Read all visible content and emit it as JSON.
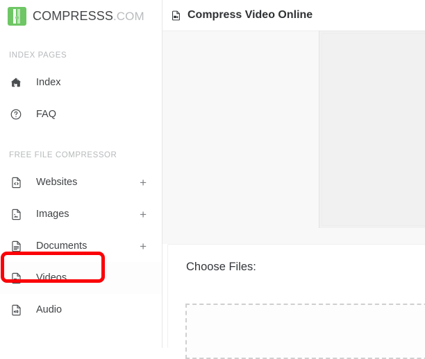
{
  "brand": {
    "name_primary": "COMPRESSS",
    "name_secondary": ".COM",
    "logo_icon": "compress-logo-icon",
    "logo_color": "#6ec664"
  },
  "sidebar": {
    "sections": [
      {
        "title": "INDEX PAGES",
        "items": [
          {
            "label": "Index",
            "icon": "home-icon",
            "expander": "",
            "active": false
          },
          {
            "label": "FAQ",
            "icon": "question-circle-icon",
            "expander": "",
            "active": false
          }
        ]
      },
      {
        "title": "FREE FILE COMPRESSOR",
        "items": [
          {
            "label": "Websites",
            "icon": "file-code-icon",
            "expander": "+",
            "active": false
          },
          {
            "label": "Images",
            "icon": "file-image-icon",
            "expander": "+",
            "active": false
          },
          {
            "label": "Documents",
            "icon": "file-document-icon",
            "expander": "+",
            "active": false
          },
          {
            "label": "Videos",
            "icon": "file-video-icon",
            "expander": "",
            "active": true
          },
          {
            "label": "Audio",
            "icon": "file-audio-icon",
            "expander": "",
            "active": false
          }
        ]
      }
    ]
  },
  "annotation": {
    "target": "Videos",
    "shape": "rounded-rectangle",
    "color": "#fb0007"
  },
  "header": {
    "icon": "file-video-icon",
    "title": "Compress Video Online"
  },
  "main": {
    "choose_files_label": "Choose Files:",
    "dropzone_text": ""
  }
}
